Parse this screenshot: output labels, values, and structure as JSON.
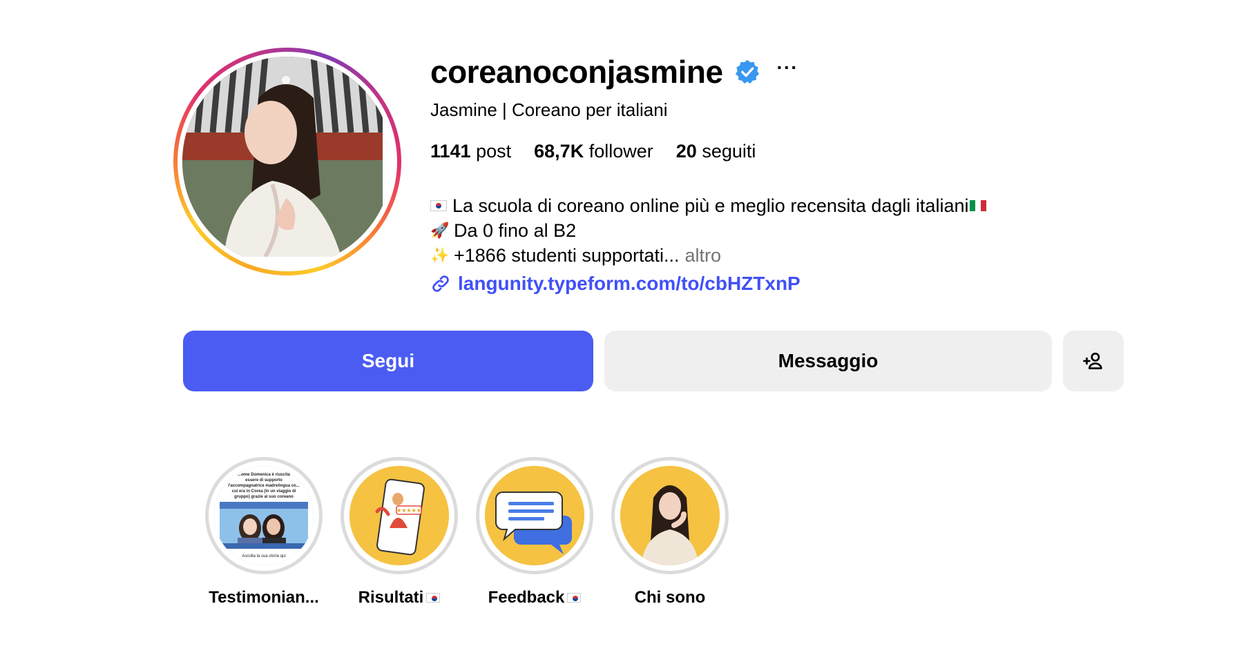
{
  "profile": {
    "username": "coreanoconjasmine",
    "full_name": "Jasmine | Coreano per italiani",
    "verified": true
  },
  "stats": {
    "posts_count": "1141",
    "posts_label": "post",
    "followers_count": "68,7K",
    "followers_label": "follower",
    "following_count": "20",
    "following_label": "seguiti"
  },
  "bio": {
    "line1": "La scuola di coreano online più e meglio recensita dagli italiani",
    "line2": "Da 0 fino al B2",
    "line3": "+1866 studenti supportati...",
    "more_label": "altro",
    "link": "langunity.typeform.com/to/cbHZTxnP"
  },
  "actions": {
    "follow_label": "Segui",
    "message_label": "Messaggio"
  },
  "highlights": [
    {
      "label": "Testimonian..."
    },
    {
      "label": "Risultati"
    },
    {
      "label": "Feedback"
    },
    {
      "label": "Chi sono"
    }
  ],
  "highlight_thumb_text": {
    "testimonial_lines": [
      "...ome Domenica è riuscita",
      "essere di supporto",
      "l'accompagnatrice madrelingua co...",
      "cui era in Corea (in un viaggio di",
      "gruppo) grazie al suo coreano"
    ],
    "testimonial_footer": "Ascolta la sua storia qui"
  },
  "colors": {
    "accent": "#4a5cf2",
    "link": "#4150f7",
    "verified_badge": "#3897f0",
    "highlight_bg": "#f5c242",
    "button_secondary": "#efefef"
  }
}
